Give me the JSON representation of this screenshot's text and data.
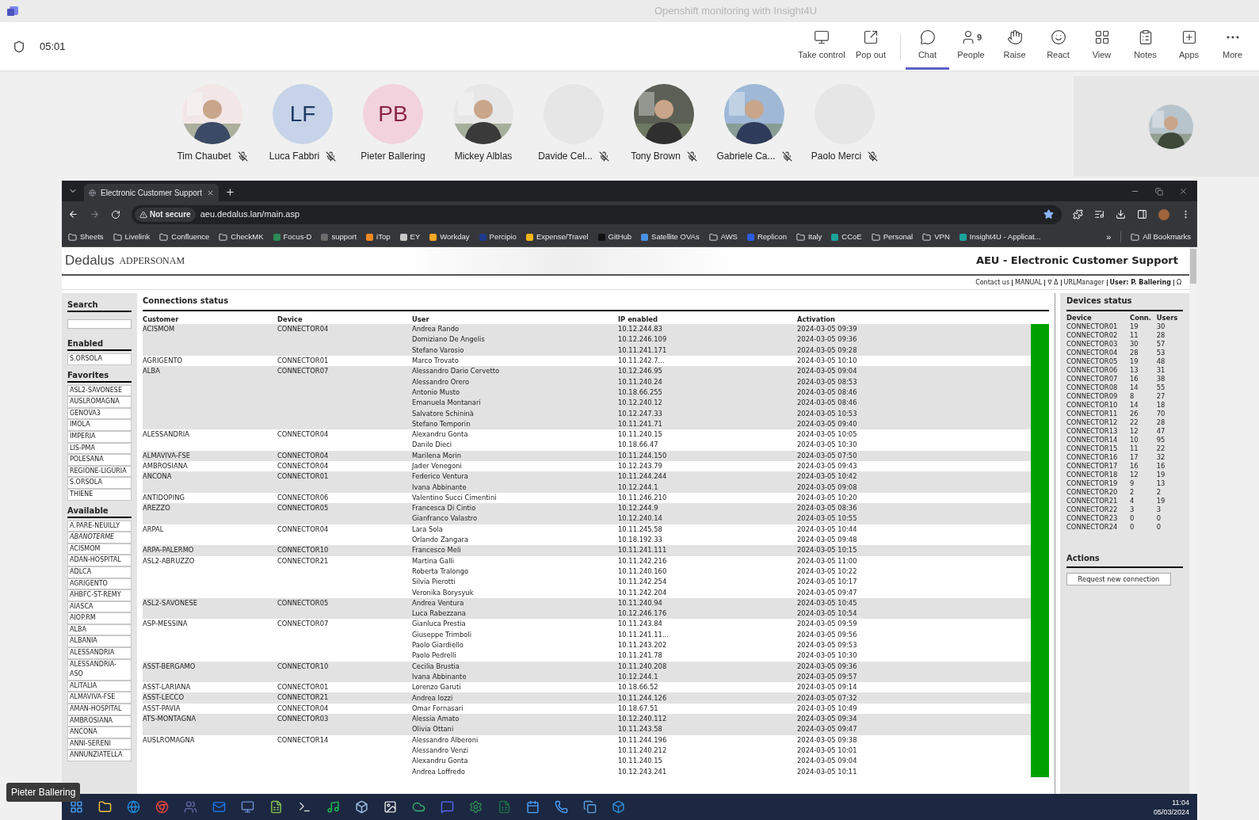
{
  "window": {
    "title": "Openshift monitoring with Insight4U"
  },
  "meeting": {
    "timer": "05:01"
  },
  "toolbar": [
    {
      "label": "Take control",
      "selected": false
    },
    {
      "label": "Pop out",
      "selected": false
    },
    {
      "label": "Chat",
      "selected": true
    },
    {
      "label": "People",
      "selected": false,
      "badge": "9"
    },
    {
      "label": "Raise",
      "selected": false
    },
    {
      "label": "React",
      "selected": false
    },
    {
      "label": "View",
      "selected": false
    },
    {
      "label": "Notes",
      "selected": false
    },
    {
      "label": "Apps",
      "selected": false
    },
    {
      "label": "More",
      "selected": false
    }
  ],
  "participants": [
    {
      "name": "Tim Chaubet",
      "muted": true
    },
    {
      "name": "Luca Fabbri",
      "kind": "initials",
      "initials": "LF",
      "color": "#c6d3e8",
      "muted": true
    },
    {
      "name": "Pieter Ballering",
      "kind": "initials",
      "initials": "PB",
      "color": "#f2d2dc",
      "muted": false
    },
    {
      "name": "Mickey Alblas",
      "muted": false
    },
    {
      "name": "Davide Cel...",
      "kind": "empty",
      "muted": true
    },
    {
      "name": "Tony Brown",
      "muted": true
    },
    {
      "name": "Gabriele Ca...",
      "muted": true
    },
    {
      "name": "Paolo Merci",
      "kind": "empty",
      "muted": true
    }
  ],
  "browser": {
    "tab": "Electronic Customer Support",
    "security": "Not secure",
    "url": "aeu.dedalus.lan/main.asp",
    "bookmarks": [
      {
        "label": "Sheets",
        "kind": "folder"
      },
      {
        "label": "Livelink",
        "kind": "folder"
      },
      {
        "label": "Confluence",
        "kind": "folder"
      },
      {
        "label": "CheckMK",
        "kind": "folder"
      },
      {
        "label": "Focus-D",
        "kind": "site",
        "color": "#2e8b57"
      },
      {
        "label": "support",
        "kind": "site",
        "color": "#6b6b6b"
      },
      {
        "label": "iTop",
        "kind": "site",
        "color": "#f08a24"
      },
      {
        "label": "EY",
        "kind": "site",
        "color": "#c8c8c8"
      },
      {
        "label": "Workday",
        "kind": "site",
        "color": "#f5a623"
      },
      {
        "label": "Percipio",
        "kind": "site",
        "color": "#1f3b8c"
      },
      {
        "label": "Expense/Travel",
        "kind": "site",
        "color": "#f2b818"
      },
      {
        "label": "GitHub",
        "kind": "site",
        "color": "#111111"
      },
      {
        "label": "Satellite OVAs",
        "kind": "site",
        "color": "#4a90e2"
      },
      {
        "label": "AWS",
        "kind": "folder"
      },
      {
        "label": "Replicon",
        "kind": "site",
        "color": "#2d5be3"
      },
      {
        "label": "Italy",
        "kind": "folder"
      },
      {
        "label": "CCoE",
        "kind": "site",
        "color": "#1aa39a"
      },
      {
        "label": "Personal",
        "kind": "folder"
      },
      {
        "label": "VPN",
        "kind": "folder"
      },
      {
        "label": "Insight4U - Applicat...",
        "kind": "site",
        "color": "#1aa39a"
      }
    ],
    "more": "»",
    "all_bookmarks": "All Bookmarks"
  },
  "page": {
    "brand": "Dedalus",
    "brand_sub": "ADPERSONAM",
    "title": "AEU - Electronic Customer Support",
    "nav": [
      "Contact us",
      "MANUAL",
      "∇ Δ",
      "URLManager",
      "User: P. Ballering",
      "Ω"
    ],
    "sidebar": {
      "search_title": "Search",
      "enabled_title": "Enabled",
      "enabled": [
        "S.ORSOLA"
      ],
      "favorites_title": "Favorites",
      "favorites": [
        "ASL2-SAVONESE",
        "AUSLROMAGNA",
        "GENOVA3",
        "IMOLA",
        "IMPERIA",
        "LIS-PMA",
        "POLESANA",
        "REGIONE-LIGURIA",
        "S.ORSOLA",
        "THIENE"
      ],
      "available_title": "Available",
      "available": [
        {
          "label": "A.PARE-NEUILLY",
          "inactive": false
        },
        {
          "label": "ABANOTERME",
          "inactive": true
        },
        {
          "label": "ACISMOM",
          "inactive": false
        },
        {
          "label": "ADAN-HOSPITAL",
          "inactive": false
        },
        {
          "label": "ADLCA",
          "inactive": false
        },
        {
          "label": "AGRIGENTO",
          "inactive": false
        },
        {
          "label": "AHBFC-ST-REMY",
          "inactive": false
        },
        {
          "label": "AIASCA",
          "inactive": false
        },
        {
          "label": "AIOP.RM",
          "inactive": false
        },
        {
          "label": "ALBA",
          "inactive": false
        },
        {
          "label": "ALBANIA",
          "inactive": false
        },
        {
          "label": "ALESSANDRIA",
          "inactive": false
        },
        {
          "label": "ALESSANDRIA-ASO",
          "inactive": false
        },
        {
          "label": "ALITALIA",
          "inactive": false
        },
        {
          "label": "ALMAVIVA-FSE",
          "inactive": false
        },
        {
          "label": "AMAN-HOSPITAL",
          "inactive": false
        },
        {
          "label": "AMBROSIANA",
          "inactive": false
        },
        {
          "label": "ANCONA",
          "inactive": false
        },
        {
          "label": "ANNI-SERENI",
          "inactive": false
        },
        {
          "label": "ANNUNZIATELLA",
          "inactive": false
        }
      ]
    },
    "connections": {
      "title": "Connections status",
      "columns": [
        "Customer",
        "Device",
        "User",
        "IP enabled",
        "Activation"
      ],
      "groups": [
        {
          "customer": "ACISMOM",
          "device": "CONNECTOR04",
          "users": [
            [
              "Andrea Rando",
              "10.12.244.83",
              "2024-03-05 09:39"
            ],
            [
              "Domiziano De Angelis",
              "10.12.246.109",
              "2024-03-05 09:36"
            ],
            [
              "Stefano Varosio",
              "10.11.241.171",
              "2024-03-05 09:28"
            ]
          ]
        },
        {
          "customer": "AGRIGENTO",
          "device": "CONNECTOR01",
          "users": [
            [
              "Marco Trovato",
              "10.11.242.7...",
              "2024-03-05 10:10"
            ]
          ]
        },
        {
          "customer": "ALBA",
          "device": "CONNECTOR07",
          "users": [
            [
              "Alessandro Dario Cervetto",
              "10.12.246.95",
              "2024-03-05 09:04"
            ],
            [
              "Alessandro Orero",
              "10.11.240.24",
              "2024-03-05 08:53"
            ],
            [
              "Antonio Musto",
              "10.18.66.255",
              "2024-03-05 08:46"
            ],
            [
              "Emanuela Montanari",
              "10.12.240.12",
              "2024-03-05 08:46"
            ],
            [
              "Salvatore Schininà",
              "10.12.247.33",
              "2024-03-05 10:53"
            ],
            [
              "Stefano Temporin",
              "10.11.241.71",
              "2024-03-05 09:40"
            ]
          ]
        },
        {
          "customer": "ALESSANDRIA",
          "device": "CONNECTOR04",
          "users": [
            [
              "Alexandru Gonta",
              "10.11.240.15",
              "2024-03-05 10:05"
            ],
            [
              "Danilo Dieci",
              "10.18.66.47",
              "2024-03-05 10:30"
            ]
          ]
        },
        {
          "customer": "ALMAVIVA-FSE",
          "device": "CONNECTOR04",
          "users": [
            [
              "Marilena Morin",
              "10.11.244.150",
              "2024-03-05 07:50"
            ]
          ]
        },
        {
          "customer": "AMBROSIANA",
          "device": "CONNECTOR04",
          "users": [
            [
              "Jader Venegoni",
              "10.12.243.79",
              "2024-03-05 09:43"
            ]
          ]
        },
        {
          "customer": "ANCONA",
          "device": "CONNECTOR01",
          "users": [
            [
              "Federico Ventura",
              "10.11.244.244",
              "2024-03-05 10:42"
            ],
            [
              "Ivana Abbinante",
              "10.12.244.1",
              "2024-03-05 09:08"
            ]
          ]
        },
        {
          "customer": "ANTIDOPING",
          "device": "CONNECTOR06",
          "users": [
            [
              "Valentino Succi Cimentini",
              "10.11.246.210",
              "2024-03-05 10:20"
            ]
          ]
        },
        {
          "customer": "AREZZO",
          "device": "CONNECTOR05",
          "users": [
            [
              "Francesca Di Cintio",
              "10.12.244.9",
              "2024-03-05 08:36"
            ],
            [
              "Gianfranco Valastro",
              "10.12.240.14",
              "2024-03-05 10:55"
            ]
          ]
        },
        {
          "customer": "ARPAL",
          "device": "CONNECTOR04",
          "users": [
            [
              "Lara Sola",
              "10.11.245.58",
              "2024-03-05 10:44"
            ],
            [
              "Orlando Zangara",
              "10.18.192.33",
              "2024-03-05 09:48"
            ]
          ]
        },
        {
          "customer": "ARPA-PALERMO",
          "device": "CONNECTOR10",
          "users": [
            [
              "Francesco Meli",
              "10.11.241.111",
              "2024-03-05 10:15"
            ]
          ]
        },
        {
          "customer": "ASL2-ABRUZZO",
          "device": "CONNECTOR21",
          "users": [
            [
              "Martina Galli",
              "10.11.242.216",
              "2024-03-05 11:00"
            ],
            [
              "Roberta Tralongo",
              "10.11.240.160",
              "2024-03-05 10:22"
            ],
            [
              "Silvia Pierotti",
              "10.11.242.254",
              "2024-03-05 10:17"
            ],
            [
              "Veronika Borysyuk",
              "10.11.242.204",
              "2024-03-05 09:47"
            ]
          ]
        },
        {
          "customer": "ASL2-SAVONESE",
          "device": "CONNECTOR05",
          "users": [
            [
              "Andrea Ventura",
              "10.11.240.94",
              "2024-03-05 10:45"
            ],
            [
              "Luca Rabezzana",
              "10.12.246.176",
              "2024-03-05 10:54"
            ]
          ]
        },
        {
          "customer": "ASP-MESSINA",
          "device": "CONNECTOR07",
          "users": [
            [
              "Gianluca Prestia",
              "10.11.243.84",
              "2024-03-05 09:59"
            ],
            [
              "Giuseppe Trimboli",
              "10.11.241.11...",
              "2024-03-05 09:56"
            ],
            [
              "Paolo Giardiello",
              "10.11.243.202",
              "2024-03-05 09:53"
            ],
            [
              "Paolo Pedrelli",
              "10.11.241.78",
              "2024-03-05 10:30"
            ]
          ]
        },
        {
          "customer": "ASST-BERGAMO",
          "device": "CONNECTOR10",
          "users": [
            [
              "Cecilia Brustia",
              "10.11.240.208",
              "2024-03-05 09:36"
            ],
            [
              "Ivana Abbinante",
              "10.12.244.1",
              "2024-03-05 09:57"
            ]
          ]
        },
        {
          "customer": "ASST-LARIANA",
          "device": "CONNECTOR01",
          "users": [
            [
              "Lorenzo Garuti",
              "10.18.66.52",
              "2024-03-05 09:14"
            ]
          ]
        },
        {
          "customer": "ASST-LECCO",
          "device": "CONNECTOR21",
          "users": [
            [
              "Andrea Iozzi",
              "10.11.244.126",
              "2024-03-05 07:32"
            ]
          ]
        },
        {
          "customer": "ASST-PAVIA",
          "device": "CONNECTOR04",
          "users": [
            [
              "Omar Fornasari",
              "10.18.67.51",
              "2024-03-05 10:49"
            ]
          ]
        },
        {
          "customer": "ATS-MONTAGNA",
          "device": "CONNECTOR03",
          "users": [
            [
              "Alessia Amato",
              "10.12.240.112",
              "2024-03-05 09:34"
            ],
            [
              "Olivia Ottani",
              "10.11.243.58",
              "2024-03-05 09:47"
            ]
          ]
        },
        {
          "customer": "AUSLROMAGNA",
          "device": "CONNECTOR14",
          "users": [
            [
              "Alessandro Alberoni",
              "10.11.244.196",
              "2024-03-05 09:38"
            ],
            [
              "Alessandro Venzi",
              "10.11.240.212",
              "2024-03-05 10:01"
            ],
            [
              "Alexandru Gonta",
              "10.11.240.15",
              "2024-03-05 09:04"
            ],
            [
              "Andrea Loffredo",
              "10.12.243.241",
              "2024-03-05 10:11"
            ]
          ]
        }
      ]
    },
    "devices": {
      "title": "Devices status",
      "columns": [
        "Device",
        "Conn.",
        "Users"
      ],
      "rows": [
        [
          "CONNECTOR01",
          "19",
          "30"
        ],
        [
          "CONNECTOR02",
          "11",
          "28"
        ],
        [
          "CONNECTOR03",
          "30",
          "57"
        ],
        [
          "CONNECTOR04",
          "28",
          "53"
        ],
        [
          "CONNECTOR05",
          "19",
          "48"
        ],
        [
          "CONNECTOR06",
          "13",
          "31"
        ],
        [
          "CONNECTOR07",
          "16",
          "38"
        ],
        [
          "CONNECTOR08",
          "14",
          "55"
        ],
        [
          "CONNECTOR09",
          "8",
          "27"
        ],
        [
          "CONNECTOR10",
          "14",
          "18"
        ],
        [
          "CONNECTOR11",
          "26",
          "70"
        ],
        [
          "CONNECTOR12",
          "22",
          "28"
        ],
        [
          "CONNECTOR13",
          "12",
          "47"
        ],
        [
          "CONNECTOR14",
          "10",
          "95"
        ],
        [
          "CONNECTOR15",
          "11",
          "22"
        ],
        [
          "CONNECTOR16",
          "17",
          "32"
        ],
        [
          "CONNECTOR17",
          "16",
          "16"
        ],
        [
          "CONNECTOR18",
          "12",
          "19"
        ],
        [
          "CONNECTOR19",
          "9",
          "13"
        ],
        [
          "CONNECTOR20",
          "2",
          "2"
        ],
        [
          "CONNECTOR21",
          "4",
          "19"
        ],
        [
          "CONNECTOR22",
          "3",
          "3"
        ],
        [
          "CONNECTOR23",
          "0",
          "0"
        ],
        [
          "CONNECTOR24",
          "0",
          "0"
        ]
      ]
    },
    "actions": {
      "title": "Actions",
      "buttons": [
        "Request new connection"
      ]
    }
  },
  "presenter": "Pieter Ballering",
  "taskbar": {
    "time": "11:04",
    "date": "05/03/2024"
  }
}
